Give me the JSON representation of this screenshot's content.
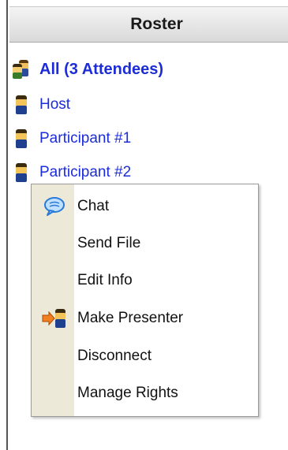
{
  "roster": {
    "title": "Roster",
    "items": [
      {
        "label": "All (3  Attendees)",
        "icon": "group-icon"
      },
      {
        "label": "Host",
        "icon": "person-icon"
      },
      {
        "label": "Participant #1",
        "icon": "person-icon"
      },
      {
        "label": "Participant #2",
        "icon": "person-icon"
      }
    ]
  },
  "context_menu": {
    "items": [
      {
        "label": "Chat",
        "icon": "chat-bubble-icon"
      },
      {
        "label": "Send File",
        "icon": ""
      },
      {
        "label": "Edit Info",
        "icon": ""
      },
      {
        "label": "Make Presenter",
        "icon": "make-presenter-icon"
      },
      {
        "label": "Disconnect",
        "icon": ""
      },
      {
        "label": "Manage Rights",
        "icon": ""
      }
    ]
  },
  "colors": {
    "link_blue": "#1c2cd8",
    "menu_gutter": "#ece9d8",
    "header_gradient_top": "#f4f4f4",
    "header_gradient_bottom": "#d9d9d9"
  }
}
